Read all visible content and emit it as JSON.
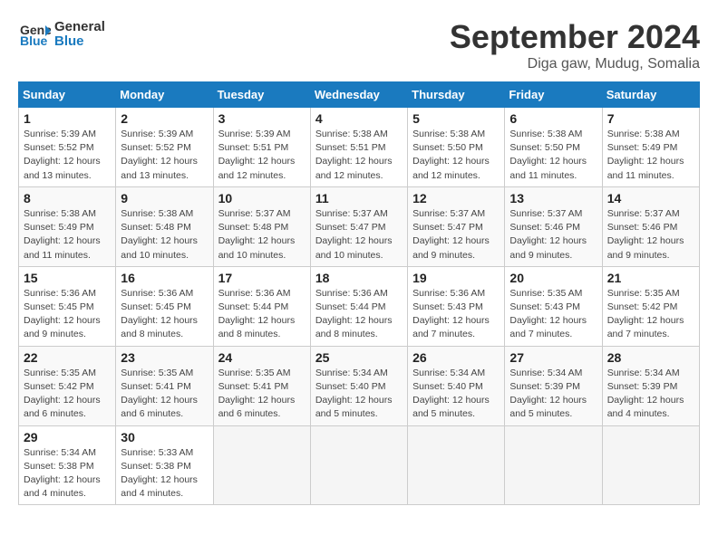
{
  "header": {
    "logo_line1": "General",
    "logo_line2": "Blue",
    "title": "September 2024",
    "subtitle": "Diga gaw, Mudug, Somalia"
  },
  "columns": [
    "Sunday",
    "Monday",
    "Tuesday",
    "Wednesday",
    "Thursday",
    "Friday",
    "Saturday"
  ],
  "weeks": [
    [
      {
        "day": "1",
        "info": "Sunrise: 5:39 AM\nSunset: 5:52 PM\nDaylight: 12 hours\nand 13 minutes."
      },
      {
        "day": "2",
        "info": "Sunrise: 5:39 AM\nSunset: 5:52 PM\nDaylight: 12 hours\nand 13 minutes."
      },
      {
        "day": "3",
        "info": "Sunrise: 5:39 AM\nSunset: 5:51 PM\nDaylight: 12 hours\nand 12 minutes."
      },
      {
        "day": "4",
        "info": "Sunrise: 5:38 AM\nSunset: 5:51 PM\nDaylight: 12 hours\nand 12 minutes."
      },
      {
        "day": "5",
        "info": "Sunrise: 5:38 AM\nSunset: 5:50 PM\nDaylight: 12 hours\nand 12 minutes."
      },
      {
        "day": "6",
        "info": "Sunrise: 5:38 AM\nSunset: 5:50 PM\nDaylight: 12 hours\nand 11 minutes."
      },
      {
        "day": "7",
        "info": "Sunrise: 5:38 AM\nSunset: 5:49 PM\nDaylight: 12 hours\nand 11 minutes."
      }
    ],
    [
      {
        "day": "8",
        "info": "Sunrise: 5:38 AM\nSunset: 5:49 PM\nDaylight: 12 hours\nand 11 minutes."
      },
      {
        "day": "9",
        "info": "Sunrise: 5:38 AM\nSunset: 5:48 PM\nDaylight: 12 hours\nand 10 minutes."
      },
      {
        "day": "10",
        "info": "Sunrise: 5:37 AM\nSunset: 5:48 PM\nDaylight: 12 hours\nand 10 minutes."
      },
      {
        "day": "11",
        "info": "Sunrise: 5:37 AM\nSunset: 5:47 PM\nDaylight: 12 hours\nand 10 minutes."
      },
      {
        "day": "12",
        "info": "Sunrise: 5:37 AM\nSunset: 5:47 PM\nDaylight: 12 hours\nand 9 minutes."
      },
      {
        "day": "13",
        "info": "Sunrise: 5:37 AM\nSunset: 5:46 PM\nDaylight: 12 hours\nand 9 minutes."
      },
      {
        "day": "14",
        "info": "Sunrise: 5:37 AM\nSunset: 5:46 PM\nDaylight: 12 hours\nand 9 minutes."
      }
    ],
    [
      {
        "day": "15",
        "info": "Sunrise: 5:36 AM\nSunset: 5:45 PM\nDaylight: 12 hours\nand 9 minutes."
      },
      {
        "day": "16",
        "info": "Sunrise: 5:36 AM\nSunset: 5:45 PM\nDaylight: 12 hours\nand 8 minutes."
      },
      {
        "day": "17",
        "info": "Sunrise: 5:36 AM\nSunset: 5:44 PM\nDaylight: 12 hours\nand 8 minutes."
      },
      {
        "day": "18",
        "info": "Sunrise: 5:36 AM\nSunset: 5:44 PM\nDaylight: 12 hours\nand 8 minutes."
      },
      {
        "day": "19",
        "info": "Sunrise: 5:36 AM\nSunset: 5:43 PM\nDaylight: 12 hours\nand 7 minutes."
      },
      {
        "day": "20",
        "info": "Sunrise: 5:35 AM\nSunset: 5:43 PM\nDaylight: 12 hours\nand 7 minutes."
      },
      {
        "day": "21",
        "info": "Sunrise: 5:35 AM\nSunset: 5:42 PM\nDaylight: 12 hours\nand 7 minutes."
      }
    ],
    [
      {
        "day": "22",
        "info": "Sunrise: 5:35 AM\nSunset: 5:42 PM\nDaylight: 12 hours\nand 6 minutes."
      },
      {
        "day": "23",
        "info": "Sunrise: 5:35 AM\nSunset: 5:41 PM\nDaylight: 12 hours\nand 6 minutes."
      },
      {
        "day": "24",
        "info": "Sunrise: 5:35 AM\nSunset: 5:41 PM\nDaylight: 12 hours\nand 6 minutes."
      },
      {
        "day": "25",
        "info": "Sunrise: 5:34 AM\nSunset: 5:40 PM\nDaylight: 12 hours\nand 5 minutes."
      },
      {
        "day": "26",
        "info": "Sunrise: 5:34 AM\nSunset: 5:40 PM\nDaylight: 12 hours\nand 5 minutes."
      },
      {
        "day": "27",
        "info": "Sunrise: 5:34 AM\nSunset: 5:39 PM\nDaylight: 12 hours\nand 5 minutes."
      },
      {
        "day": "28",
        "info": "Sunrise: 5:34 AM\nSunset: 5:39 PM\nDaylight: 12 hours\nand 4 minutes."
      }
    ],
    [
      {
        "day": "29",
        "info": "Sunrise: 5:34 AM\nSunset: 5:38 PM\nDaylight: 12 hours\nand 4 minutes."
      },
      {
        "day": "30",
        "info": "Sunrise: 5:33 AM\nSunset: 5:38 PM\nDaylight: 12 hours\nand 4 minutes."
      },
      {
        "day": "",
        "info": ""
      },
      {
        "day": "",
        "info": ""
      },
      {
        "day": "",
        "info": ""
      },
      {
        "day": "",
        "info": ""
      },
      {
        "day": "",
        "info": ""
      }
    ]
  ]
}
